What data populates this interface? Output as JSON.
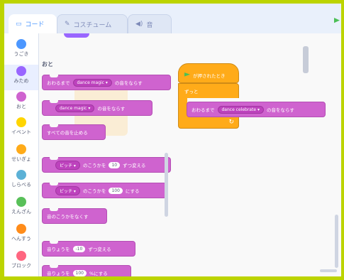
{
  "tabs": [
    {
      "label": "コード",
      "icon": "code-icon"
    },
    {
      "label": "コスチューム",
      "icon": "brush-icon"
    },
    {
      "label": "音",
      "icon": "speaker-icon"
    }
  ],
  "categories": [
    {
      "label": "うごき",
      "color": "#4c97ff"
    },
    {
      "label": "みため",
      "color": "#9966ff"
    },
    {
      "label": "おと",
      "color": "#cf63cf"
    },
    {
      "label": "イベント",
      "color": "#ffd500"
    },
    {
      "label": "せいぎょ",
      "color": "#ffab19"
    },
    {
      "label": "しらべる",
      "color": "#5cb1d6"
    },
    {
      "label": "えんざん",
      "color": "#59c059"
    },
    {
      "label": "へんすう",
      "color": "#ff8c1a"
    },
    {
      "label": "ブロック",
      "color": "#ff6680"
    }
  ],
  "palette": {
    "section_title": "おと",
    "blocks": [
      {
        "pre": "おわるまで",
        "dropdown": "dance magic",
        "post": "の音をならす"
      },
      {
        "pre": "",
        "dropdown": "dance magic",
        "post": "の音をならす"
      },
      {
        "pre": "すべての音を止める",
        "dropdown": "",
        "post": ""
      },
      {
        "pre": "",
        "dropdown": "ピッチ",
        "mid": "のこうかを",
        "value": "10",
        "post": "ずつ変える"
      },
      {
        "pre": "",
        "dropdown": "ピッチ",
        "mid": "のこうかを",
        "value": "100",
        "post": "にする"
      },
      {
        "pre": "音のこうかをなくす",
        "dropdown": "",
        "post": ""
      },
      {
        "pre": "音りょうを",
        "value": "-10",
        "post": "ずつ変える"
      },
      {
        "pre": "音りょうを",
        "value": "100",
        "post": "%にする"
      }
    ]
  },
  "script": {
    "hat_label": "が押されたとき",
    "loop_label": "ずっと",
    "inner_pre": "おわるまで",
    "inner_dropdown": "dance celebrate",
    "inner_post": "の音をならす",
    "loop_arrow": "↻"
  },
  "colors": {
    "sound": "#cf63cf",
    "control": "#ffab19",
    "frame": "#bcd400"
  }
}
